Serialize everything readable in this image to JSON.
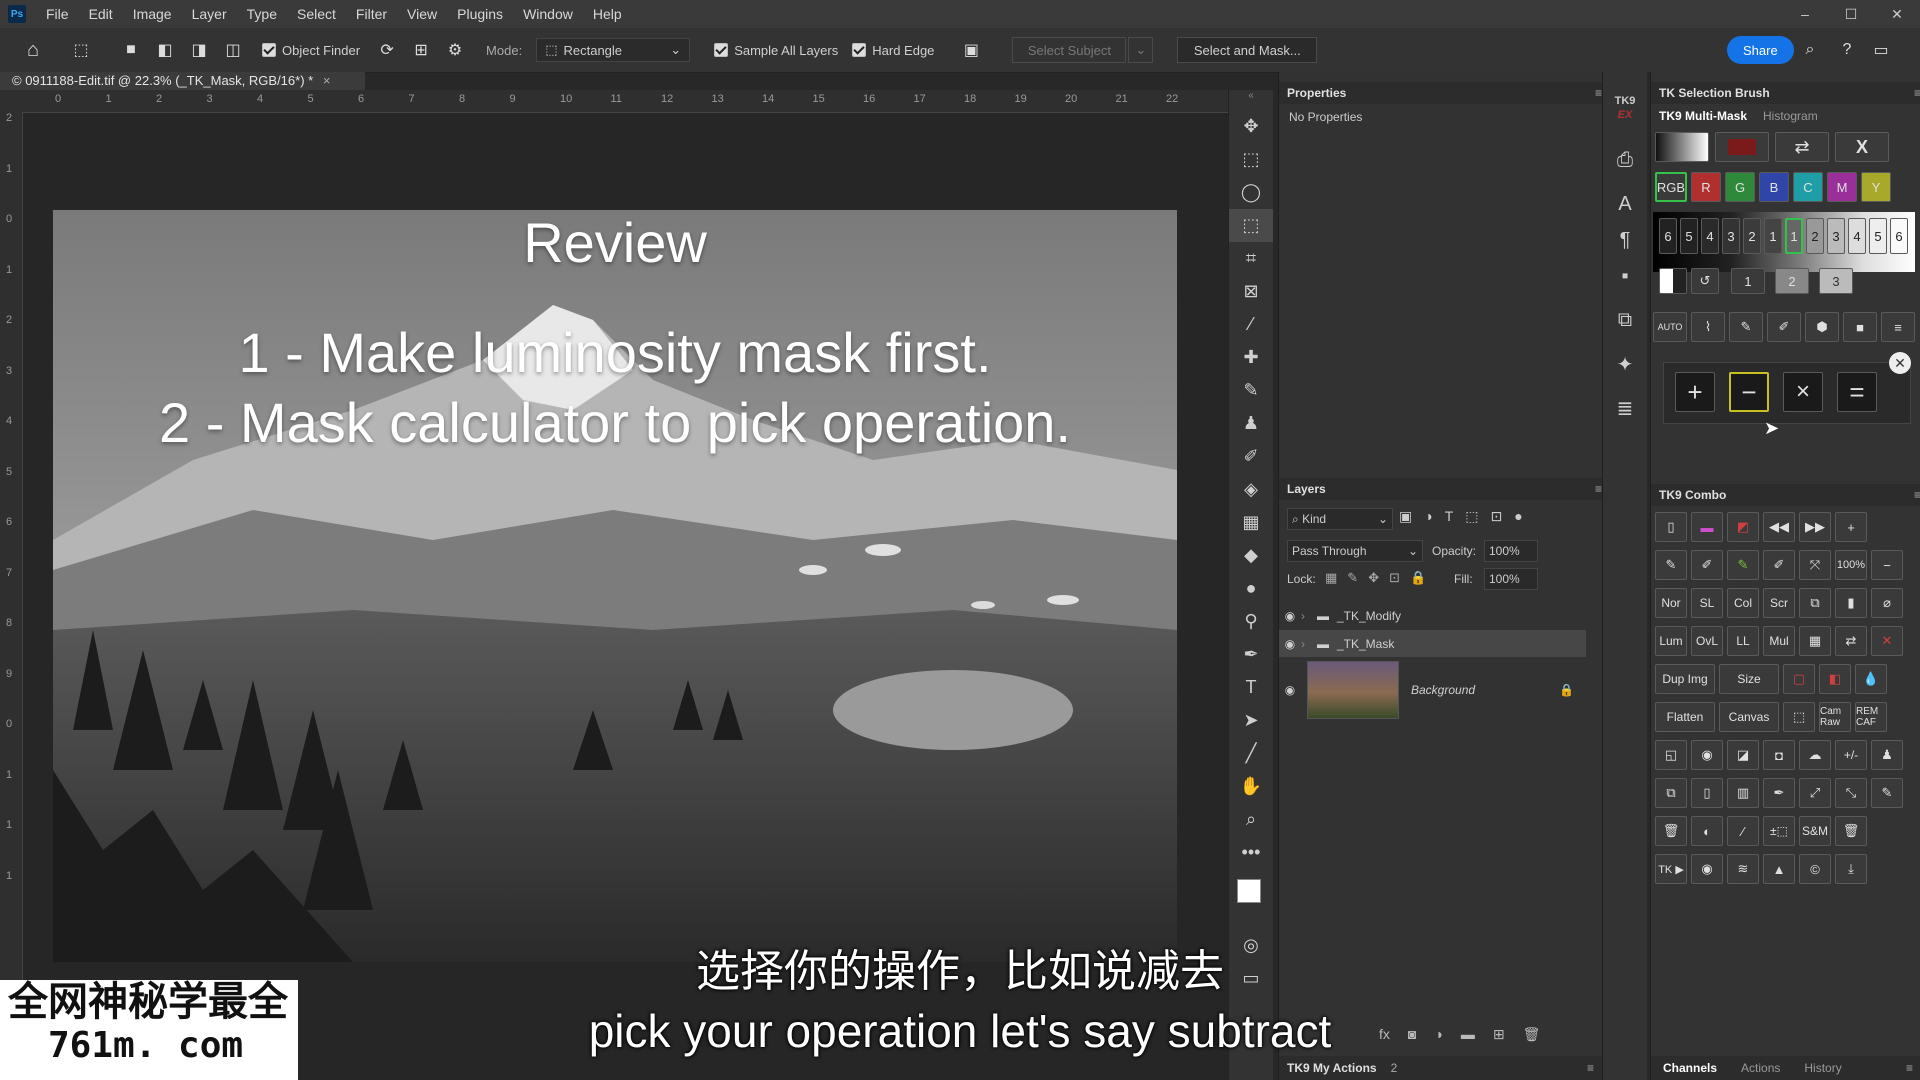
{
  "menubar": {
    "logo": "Ps",
    "items": [
      "File",
      "Edit",
      "Image",
      "Layer",
      "Type",
      "Select",
      "Filter",
      "View",
      "Plugins",
      "Window",
      "Help"
    ]
  },
  "options": {
    "object_finder": "Object Finder",
    "mode_label": "Mode:",
    "mode_value": "Rectangle",
    "sample_all_layers": "Sample All Layers",
    "hard_edge": "Hard Edge",
    "select_subject": "Select Subject",
    "select_and_mask": "Select and Mask...",
    "share": "Share"
  },
  "document": {
    "tab_title": "© 0911188-Edit.tif @ 22.3% (_TK_Mask, RGB/16*) *",
    "ruler_top": [
      "0",
      "1",
      "2",
      "3",
      "4",
      "5",
      "6",
      "7",
      "8",
      "9",
      "10",
      "11",
      "12",
      "13",
      "14",
      "15",
      "16",
      "17",
      "18",
      "19",
      "20",
      "21",
      "22"
    ],
    "ruler_left": [
      "2",
      "1",
      "0",
      "1",
      "2",
      "3",
      "4",
      "5",
      "6",
      "7",
      "8",
      "9",
      "0",
      "1",
      "1",
      "1"
    ],
    "image_text": {
      "title": "Review",
      "line1": "1 - Make luminosity mask first.",
      "line2": "2 - Mask calculator to pick operation."
    }
  },
  "properties": {
    "title": "Properties",
    "empty": "No Properties"
  },
  "layers": {
    "title": "Layers",
    "kind": "Kind",
    "blend_mode": "Pass Through",
    "opacity_label": "Opacity:",
    "opacity_value": "100%",
    "lock_label": "Lock:",
    "fill_label": "Fill:",
    "fill_value": "100%",
    "items": [
      {
        "name": "_TK_Modify",
        "type": "group"
      },
      {
        "name": "_TK_Mask",
        "type": "group"
      },
      {
        "name": "Background",
        "type": "image"
      }
    ]
  },
  "tk_my_actions": {
    "label": "TK9 My Actions",
    "count": "2"
  },
  "tk": {
    "ex_label": "TK9",
    "ex_sub": "EX",
    "selection_brush": "TK Selection Brush",
    "multimask_tab": "TK9 Multi-Mask",
    "histogram_tab": "Histogram",
    "channels": [
      "RGB",
      "R",
      "G",
      "B",
      "C",
      "M",
      "Y"
    ],
    "channel_colors": [
      "#3a3a3a",
      "#b03030",
      "#2e8a3a",
      "#2f46a8",
      "#1f9ea8",
      "#9a2f9a",
      "#a8a82a"
    ],
    "levels": [
      "6",
      "5",
      "4",
      "3",
      "2",
      "1",
      "1",
      "2",
      "3",
      "4",
      "5",
      "6"
    ],
    "sub_levels": [
      "1",
      "2",
      "3"
    ],
    "ops": [
      "+",
      "−",
      "×",
      "="
    ],
    "combo_title": "TK9 Combo",
    "combo_zoom": "100%",
    "combo_text_row1": [
      "Nor",
      "SL",
      "Col",
      "Scr"
    ],
    "combo_text_row2": [
      "Lum",
      "OvL",
      "LL",
      "Mul"
    ],
    "combo_buttons": [
      "Dup Img",
      "Size",
      "Flatten",
      "Canvas"
    ],
    "cam_raw": "Cam Raw",
    "rem_caf": "REM CAF",
    "plusminus": "+/-",
    "sm": "S&M",
    "tk_play": "TK ▶",
    "bottom_tabs": [
      "Channels",
      "Actions",
      "History"
    ]
  },
  "subtitles": {
    "cn": "选择你的操作，比如说减去",
    "en": "pick your operation let's say subtract"
  },
  "watermark": {
    "line1": "全网神秘学最全",
    "line2": "761m. com"
  }
}
